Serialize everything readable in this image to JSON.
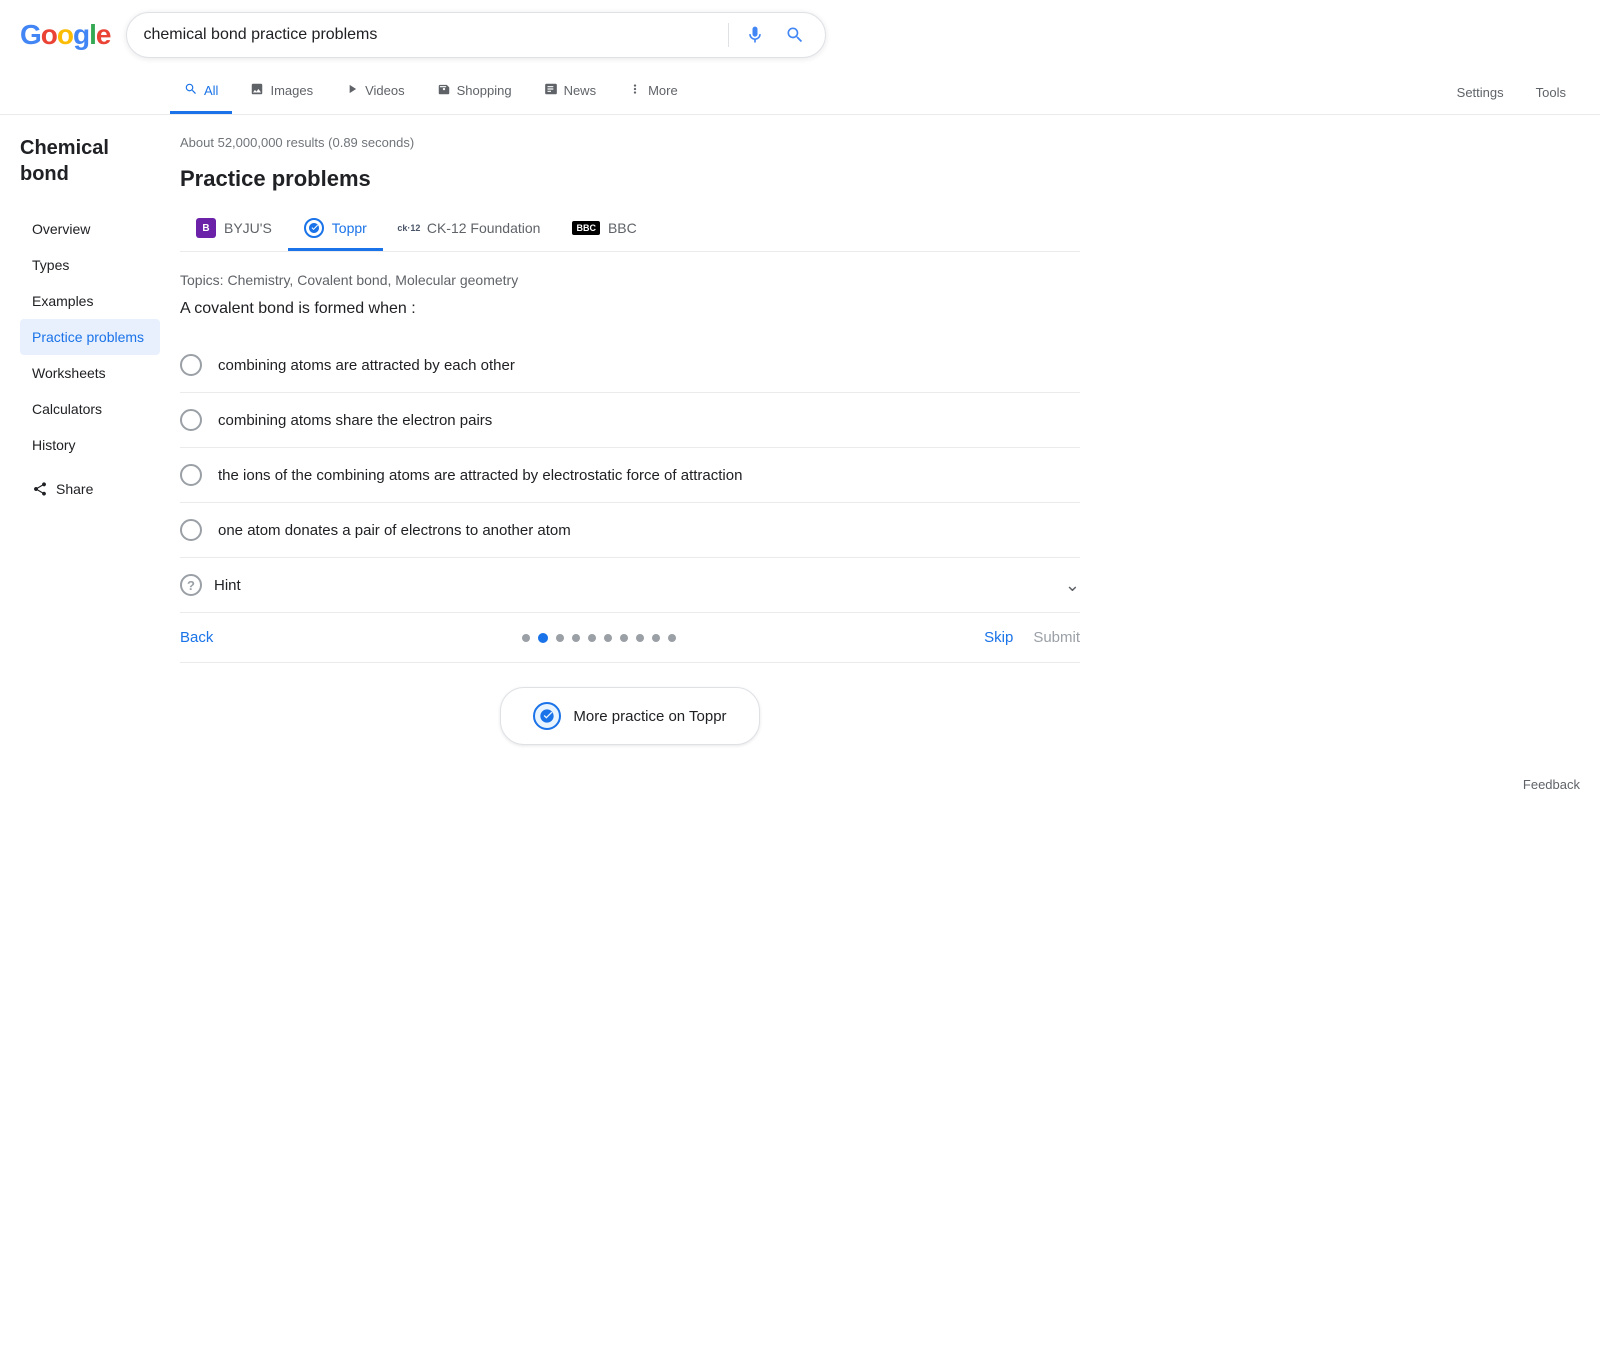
{
  "header": {
    "logo": "Google",
    "search_query": "chemical bond practice problems",
    "clear_label": "×",
    "search_label": "Search"
  },
  "nav": {
    "tabs": [
      {
        "id": "all",
        "label": "All",
        "icon": "search",
        "active": true
      },
      {
        "id": "images",
        "label": "Images",
        "icon": "image"
      },
      {
        "id": "videos",
        "label": "Videos",
        "icon": "play"
      },
      {
        "id": "shopping",
        "label": "Shopping",
        "icon": "tag"
      },
      {
        "id": "news",
        "label": "News",
        "icon": "newspaper"
      },
      {
        "id": "more",
        "label": "More",
        "icon": "dots"
      }
    ],
    "settings": "Settings",
    "tools": "Tools"
  },
  "results_count": "About 52,000,000 results (0.89 seconds)",
  "sidebar": {
    "title": "Chemical bond",
    "items": [
      {
        "label": "Overview",
        "active": false
      },
      {
        "label": "Types",
        "active": false
      },
      {
        "label": "Examples",
        "active": false
      },
      {
        "label": "Practice problems",
        "active": true
      },
      {
        "label": "Worksheets",
        "active": false
      },
      {
        "label": "Calculators",
        "active": false
      },
      {
        "label": "History",
        "active": false
      }
    ],
    "share": "Share"
  },
  "practice": {
    "title": "Practice problems",
    "sources": [
      {
        "id": "byjus",
        "label": "BYJU'S",
        "active": false
      },
      {
        "id": "toppr",
        "label": "Toppr",
        "active": true
      },
      {
        "id": "ck12",
        "label": "CK-12 Foundation",
        "active": false
      },
      {
        "id": "bbc",
        "label": "BBC",
        "active": false
      }
    ],
    "topics": "Topics: Chemistry, Covalent bond, Molecular geometry",
    "question": "A covalent bond is formed when :",
    "options": [
      {
        "id": "a",
        "text": "combining atoms are attracted by each other"
      },
      {
        "id": "b",
        "text": "combining atoms share the electron pairs"
      },
      {
        "id": "c",
        "text": "the ions of the combining atoms are attracted by electrostatic force of attraction"
      },
      {
        "id": "d",
        "text": "one atom donates a pair of electrons to another atom"
      }
    ],
    "hint_label": "Hint",
    "nav": {
      "back": "Back",
      "skip": "Skip",
      "submit": "Submit",
      "dots_count": 10,
      "active_dot": 1
    },
    "more_practice": "More practice on Toppr"
  },
  "feedback": "Feedback"
}
